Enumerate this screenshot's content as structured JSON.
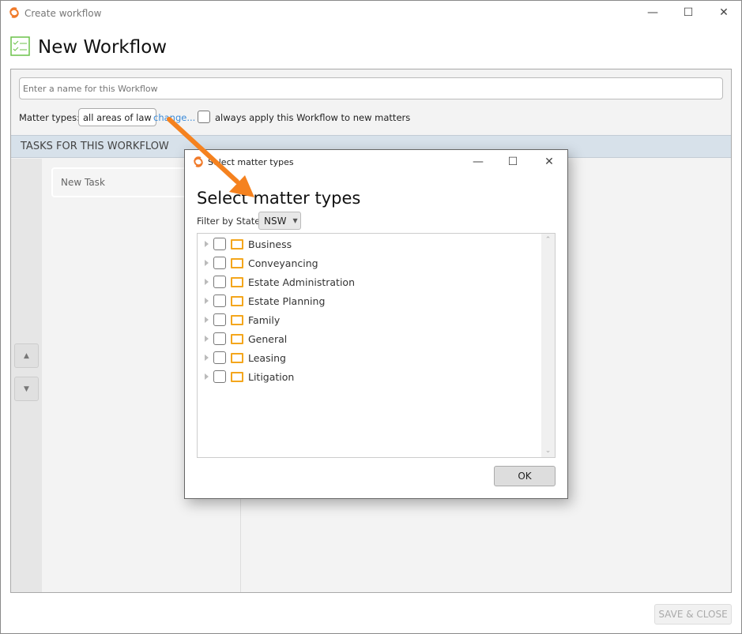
{
  "window": {
    "title": "Create workflow",
    "heading": "New Workflow"
  },
  "form": {
    "name_placeholder": "Enter a name for this Workflow",
    "matter_types_label": "Matter types:",
    "matter_types_value": "all areas of law",
    "change_link": "change...",
    "always_apply_label": "always apply this Workflow to new matters",
    "always_apply_checked": false
  },
  "tasks": {
    "header": "TASKS FOR THIS WORKFLOW",
    "items": [
      "New Task"
    ],
    "move_up": "▲",
    "move_down": "▼"
  },
  "footer": {
    "save_close": "SAVE & CLOSE"
  },
  "dialog": {
    "title": "Select matter types",
    "heading": "Select matter types",
    "filter_label": "Filter by State",
    "state_value": "NSW",
    "items": [
      "Business",
      "Conveyancing",
      "Estate Administration",
      "Estate Planning",
      "Family",
      "General",
      "Leasing",
      "Litigation"
    ],
    "ok": "OK"
  },
  "colors": {
    "brand": "#f07a2a",
    "annotation_arrow": "#f5821f",
    "folder": "#f4a61c",
    "header_band": "#d7e1ea"
  }
}
